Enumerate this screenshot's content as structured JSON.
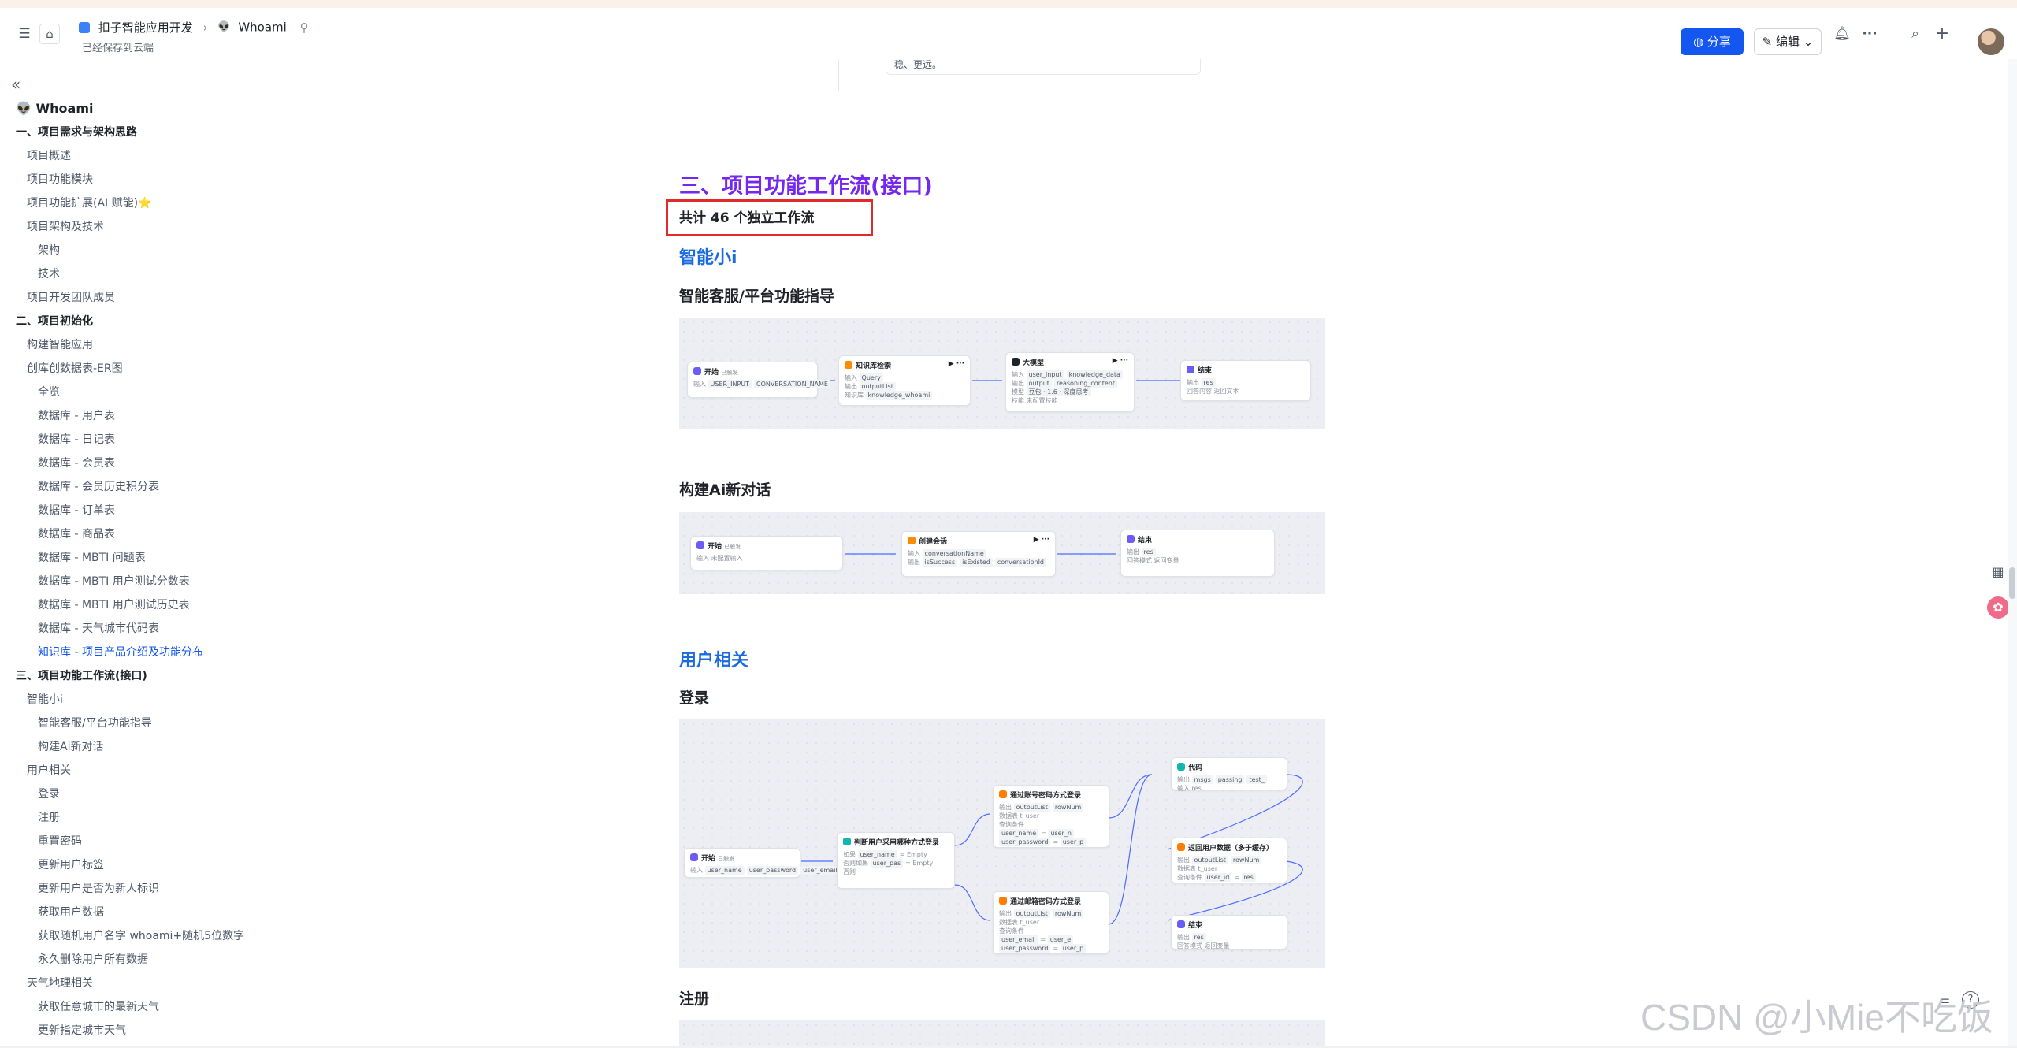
{
  "header": {
    "space_name": "扣子智能应用开发",
    "doc_title": "Whoami",
    "saved_status": "已经保存到云端",
    "share_label": "分享",
    "edit_label": "编辑"
  },
  "sidebar": {
    "items": [
      {
        "label": "Whoami",
        "level": 0
      },
      {
        "label": "一、项目需求与架构思路",
        "level": 1
      },
      {
        "label": "项目概述",
        "level": 2
      },
      {
        "label": "项目功能模块",
        "level": 2
      },
      {
        "label": "项目功能扩展(AI 赋能)⭐",
        "level": 2
      },
      {
        "label": "项目架构及技术",
        "level": 2
      },
      {
        "label": "架构",
        "level": 3
      },
      {
        "label": "技术",
        "level": 3
      },
      {
        "label": "项目开发团队成员",
        "level": 2
      },
      {
        "label": "二、项目初始化",
        "level": 1
      },
      {
        "label": "构建智能应用",
        "level": 2
      },
      {
        "label": "创库创数据表-ER图",
        "level": 2
      },
      {
        "label": "全览",
        "level": 3
      },
      {
        "label": "数据库 - 用户表",
        "level": 3
      },
      {
        "label": "数据库 - 日记表",
        "level": 3
      },
      {
        "label": "数据库 - 会员表",
        "level": 3
      },
      {
        "label": "数据库 - 会员历史积分表",
        "level": 3
      },
      {
        "label": "数据库 - 订单表",
        "level": 3
      },
      {
        "label": "数据库 - 商品表",
        "level": 3
      },
      {
        "label": "数据库 - MBTI 问题表",
        "level": 3
      },
      {
        "label": "数据库 - MBTI 用户测试分数表",
        "level": 3
      },
      {
        "label": "数据库 - MBTI 用户测试历史表",
        "level": 3
      },
      {
        "label": "数据库 - 天气城市代码表",
        "level": 3
      },
      {
        "label": "知识库 - 项目产品介绍及功能分布",
        "level": 3,
        "active": true
      },
      {
        "label": "三、项目功能工作流(接口)",
        "level": 1
      },
      {
        "label": "智能小i",
        "level": 2
      },
      {
        "label": "智能客服/平台功能指导",
        "level": 3
      },
      {
        "label": "构建Ai新对话",
        "level": 3
      },
      {
        "label": "用户相关",
        "level": 2
      },
      {
        "label": "登录",
        "level": 3
      },
      {
        "label": "注册",
        "level": 3
      },
      {
        "label": "重置密码",
        "level": 3
      },
      {
        "label": "更新用户标签",
        "level": 3
      },
      {
        "label": "更新用户是否为新人标识",
        "level": 3
      },
      {
        "label": "获取用户数据",
        "level": 3
      },
      {
        "label": "获取随机用户名字 whoami+随机5位数字",
        "level": 3
      },
      {
        "label": "永久删除用户所有数据",
        "level": 3
      },
      {
        "label": "天气地理相关",
        "level": 2
      },
      {
        "label": "获取任意城市的最新天气",
        "level": 3
      },
      {
        "label": "更新指定城市天气",
        "level": 3
      }
    ]
  },
  "content": {
    "prev_card_text": "稳、更远。",
    "section_title": "三、项目功能工作流(接口)",
    "workflow_count_note": "共计 46 个独立工作流",
    "sub1_title": "智能小i",
    "flow1_title": "智能客服/平台功能指导",
    "flow2_title": "构建Ai新对话",
    "sub2_title": "用户相关",
    "flow3_title": "登录",
    "flow4_title": "注册"
  },
  "flow1": {
    "start": {
      "title": "开始",
      "sub": "已触发",
      "row": "输入",
      "tags": [
        "USER_INPUT",
        "CONVERSATION_NAME"
      ]
    },
    "kb": {
      "title": "知识库检索",
      "in_label": "输入",
      "in_tag": "Query",
      "out_label": "输出",
      "out_tag": "outputList",
      "kb_label": "知识库",
      "kb_tag": "knowledge_whoami"
    },
    "llm": {
      "title": "大模型",
      "in_label": "输入",
      "in_tags": [
        "user_input",
        "knowledge_data"
      ],
      "out_label": "输出",
      "out_tags": [
        "output",
        "reasoning_content"
      ],
      "model_label": "模型",
      "model_tag": "豆包 · 1.6 · 深度思考",
      "skill_label": "技能",
      "skill_text": "未配置技能"
    },
    "end": {
      "title": "结束",
      "out_label": "输出",
      "out_tag": "res",
      "mode_label": "回答内容",
      "mode_text": "返回文本"
    }
  },
  "flow2": {
    "start": {
      "title": "开始",
      "sub": "已触发",
      "row_label": "输入",
      "row_text": "未配置输入"
    },
    "create": {
      "title": "创建会话",
      "in_label": "输入",
      "in_tag": "conversationName",
      "out_label": "输出",
      "out_tags": [
        "isSuccess",
        "isExisted",
        "conversationId"
      ]
    },
    "end": {
      "title": "结束",
      "out_label": "输出",
      "out_tag": "res",
      "mode_label": "回答模式",
      "mode_text": "返回变量"
    }
  },
  "flow3": {
    "start": {
      "title": "开始",
      "sub": "已触发",
      "row_label": "输入",
      "tags": [
        "user_name",
        "user_password",
        "user_email"
      ]
    },
    "cond": {
      "title": "判断用户采用哪种方式登录",
      "r1": "如果",
      "r1a": "user_name",
      "r1b": "Empty",
      "r2": "否则如果",
      "r2a": "user_pas",
      "r2b": "Empty",
      "r3": "否则"
    },
    "db1": {
      "title": "通过账号密码方式登录",
      "in_label": "输出",
      "tags": [
        "outputList",
        "rowNum"
      ],
      "tbl_label": "数据表",
      "tbl": "t_user",
      "cond_label": "查询条件",
      "c1": "user_name",
      "c1b": "user_n",
      "c2": "user_password",
      "c2b": "user_p"
    },
    "db2": {
      "title": "通过邮箱密码方式登录",
      "in_label": "输出",
      "tags": [
        "outputList",
        "rowNum"
      ],
      "tbl_label": "数据表",
      "tbl": "t_user",
      "cond_label": "查询条件",
      "c1": "user_email",
      "c1b": "user_e",
      "c2": "user_password",
      "c2b": "user_p"
    },
    "code": {
      "title": "代码",
      "in_label": "输出",
      "tags": [
        "msgs",
        "passing",
        "test_"
      ],
      "row2_label": "输入",
      "row2": "res"
    },
    "db3": {
      "title": "返回用户数据（多于缓存）",
      "in_label": "输出",
      "tags": [
        "outputList",
        "rowNum"
      ],
      "tbl_label": "数据表",
      "tbl": "t_user",
      "cond_label": "查询条件",
      "c1": "user_id",
      "c1b": "res"
    },
    "end": {
      "title": "结束",
      "out_label": "输出",
      "out_tag": "res",
      "mode_label": "回答模式",
      "mode_text": "返回变量"
    }
  },
  "watermark": "CSDN @小Mie不吃饭",
  "colors": {
    "accent": "#1456f0",
    "heading_purple": "#7327f0",
    "heading_blue": "#1a6ae0",
    "highlight_red": "#e02b2b"
  }
}
